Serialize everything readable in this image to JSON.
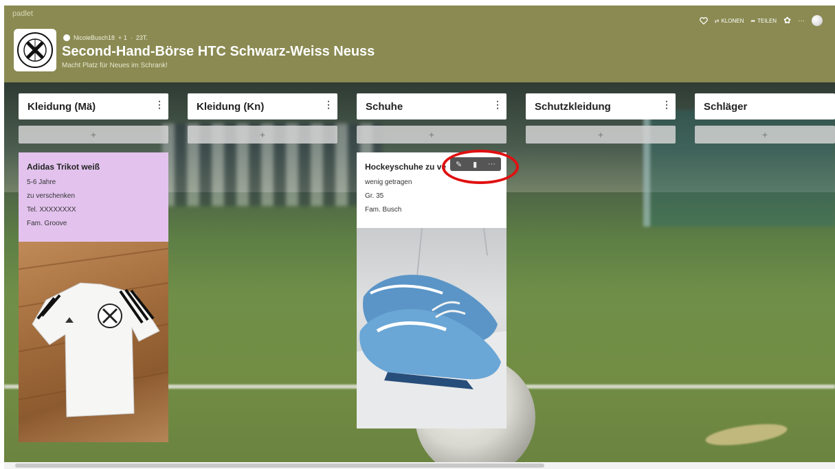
{
  "app": {
    "brand": "padlet"
  },
  "board": {
    "author": "NicoleBusch18",
    "plus": "+ 1",
    "age": "23T.",
    "title": "Second-Hand-Börse HTC Schwarz-Weiss Neuss",
    "subtitle": "Macht Platz für Neues im Schrank!"
  },
  "actions": {
    "clone": "KLONEN",
    "share": "TEILEN",
    "more": "···"
  },
  "columns": [
    {
      "title": "Kleidung (Mä)",
      "add": "+"
    },
    {
      "title": "Kleidung (Kn)",
      "add": "+"
    },
    {
      "title": "Schuhe",
      "add": "+"
    },
    {
      "title": "Schutzkleidung",
      "add": "+"
    },
    {
      "title": "Schläger",
      "add": "+"
    }
  ],
  "cards": [
    {
      "title": "Adidas Trikot weiß",
      "lines": [
        "5-6 Jahre",
        "zu verschenken",
        "Tel. XXXXXXXX",
        "Fam. Groove"
      ],
      "color": "#e3c3ee"
    },
    {
      "title": "Hockeyschuhe zu ve",
      "lines": [
        "wenig getragen",
        "Gr. 35",
        "Fam. Busch"
      ],
      "color": "#ffffff"
    }
  ],
  "colors": {
    "header": "#8a8a52",
    "highlight": "#e01010"
  }
}
